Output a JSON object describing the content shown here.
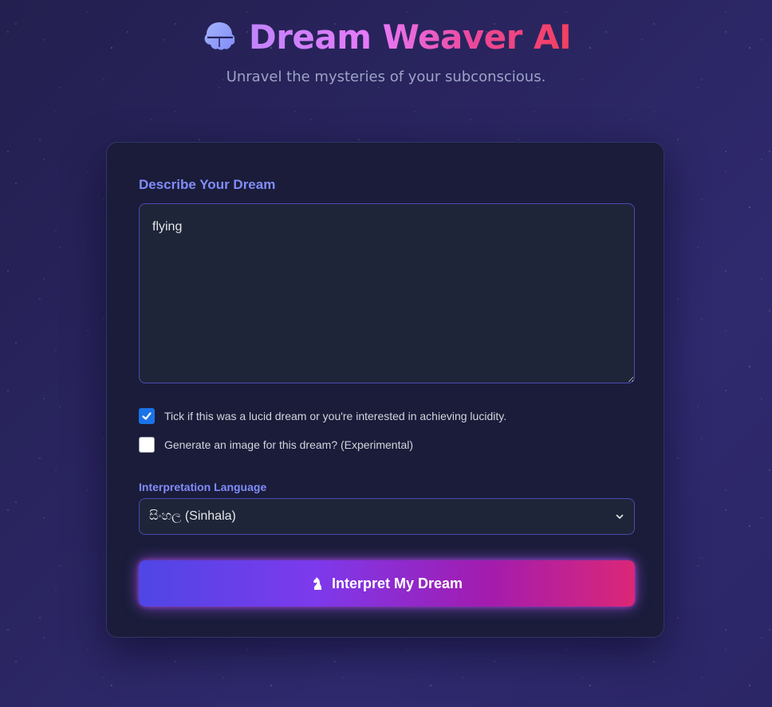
{
  "header": {
    "title": "Dream Weaver AI",
    "subtitle": "Unravel the mysteries of your subconscious.",
    "logo_icon": "brain-icon"
  },
  "form": {
    "dream_label": "Describe Your Dream",
    "dream_value": "flying",
    "lucid_checkbox": {
      "label": "Tick if this was a lucid dream or you're interested in achieving lucidity.",
      "checked": true
    },
    "image_checkbox": {
      "label": "Generate an image for this dream? (Experimental)",
      "checked": false
    },
    "language_label": "Interpretation Language",
    "language_selected": "සිංහල (Sinhala)",
    "submit_label": "Interpret My Dream",
    "submit_icon": "chess-knight-icon"
  },
  "colors": {
    "accent_label": "#818cf8",
    "button_gradient_start": "#4f46e5",
    "button_gradient_end": "#db2777",
    "checkbox_checked": "#1a73e8"
  }
}
